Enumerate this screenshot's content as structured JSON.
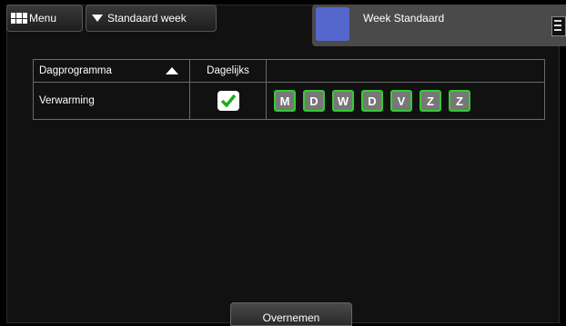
{
  "toolbar": {
    "menu_label": "Menu",
    "week_select_label": "Standaard week"
  },
  "week_panel": {
    "title": "Week Standaard",
    "color": "#5566cc"
  },
  "table": {
    "headers": [
      "Dagprogramma",
      "Dagelijks",
      ""
    ],
    "sort_indicator": "triangle-up-icon",
    "rows": [
      {
        "name": "Verwarming",
        "daily_checked": true,
        "days": [
          "M",
          "D",
          "W",
          "D",
          "V",
          "Z",
          "Z"
        ]
      }
    ]
  },
  "footer": {
    "apply_label": "Overnemen"
  },
  "colors": {
    "day_border": "#33cc33",
    "check": "#22aa22"
  }
}
